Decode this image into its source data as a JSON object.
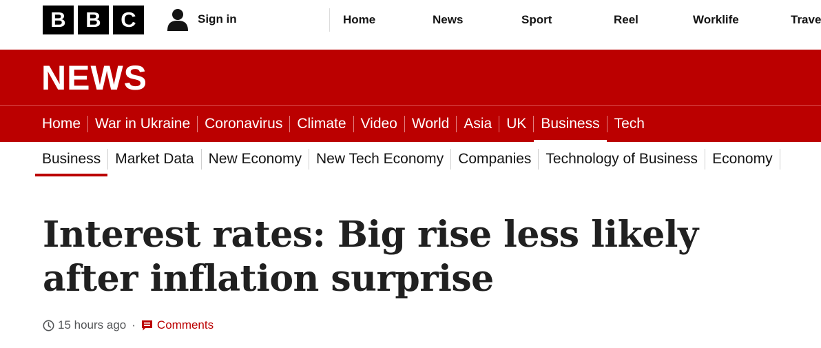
{
  "logo": {
    "letters": [
      "B",
      "B",
      "C"
    ]
  },
  "signin": {
    "label": "Sign in",
    "icon": "user-icon"
  },
  "topnav": [
    {
      "label": "Home"
    },
    {
      "label": "News"
    },
    {
      "label": "Sport"
    },
    {
      "label": "Reel"
    },
    {
      "label": "Worklife"
    },
    {
      "label": "Trave"
    }
  ],
  "news_bar": {
    "title": "NEWS"
  },
  "section_nav": [
    {
      "label": "Home"
    },
    {
      "label": "War in Ukraine"
    },
    {
      "label": "Coronavirus"
    },
    {
      "label": "Climate"
    },
    {
      "label": "Video"
    },
    {
      "label": "World"
    },
    {
      "label": "Asia"
    },
    {
      "label": "UK"
    },
    {
      "label": "Business",
      "active": true
    },
    {
      "label": "Tech"
    }
  ],
  "sub_nav": [
    {
      "label": "Business",
      "active": true
    },
    {
      "label": "Market Data"
    },
    {
      "label": "New Economy"
    },
    {
      "label": "New Tech Economy"
    },
    {
      "label": "Companies"
    },
    {
      "label": "Technology of Business"
    },
    {
      "label": "Economy"
    }
  ],
  "article": {
    "headline": "Interest rates: Big rise less likely after inflation surprise",
    "timestamp": "15 hours ago",
    "separator": "·",
    "comments_label": "Comments"
  },
  "colors": {
    "brand_red": "#bb0000",
    "text": "#141414",
    "meta": "#545658"
  }
}
